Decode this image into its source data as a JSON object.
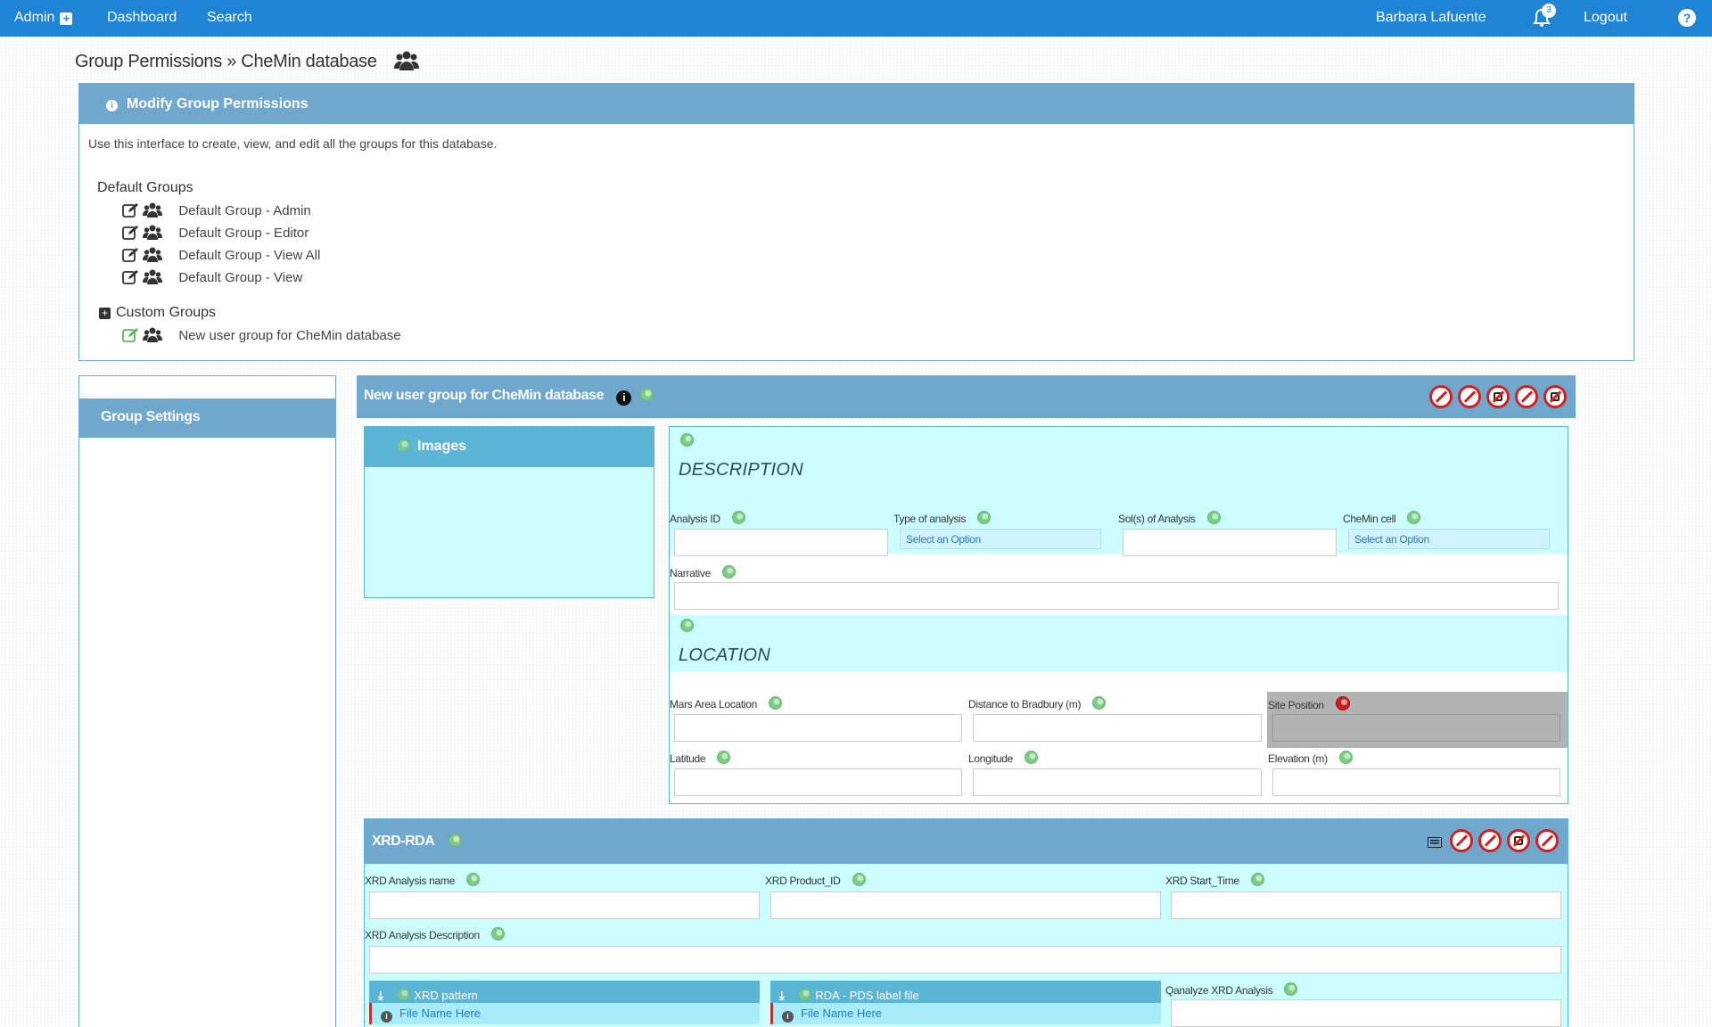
{
  "nav": {
    "admin": "Admin",
    "dashboard": "Dashboard",
    "search": "Search",
    "user": "Barbara Lafuente",
    "notif_count": "3",
    "logout": "Logout"
  },
  "page": {
    "title": "Group Permissions » CheMin database"
  },
  "modify": {
    "heading": "Modify Group Permissions",
    "intro": "Use this interface to create, view, and edit all the groups for this database.",
    "default_label": "Default Groups",
    "default_groups": [
      "Default Group - Admin",
      "Default Group - Editor",
      "Default Group - View All",
      "Default Group - View"
    ],
    "custom_label": "Custom Groups",
    "custom_groups": [
      "New user group for CheMin database"
    ]
  },
  "sidebar": {
    "group_settings": "Group Settings"
  },
  "group_panel": {
    "title": "New user group for CheMin database",
    "images_label": "Images",
    "description": {
      "heading": "DESCRIPTION",
      "analysis_id": "Analysis ID",
      "type_of_analysis": "Type of analysis",
      "sols": "Sol(s) of Analysis",
      "chemin_cell": "CheMin cell",
      "select_placeholder": "Select an Option",
      "narrative": "Narrative"
    },
    "location": {
      "heading": "LOCATION",
      "mars_area": "Mars Area Location",
      "distance": "Distance to Bradbury (m)",
      "site_position": "Site Position",
      "latitude": "Latitude",
      "longitude": "Longitude",
      "elevation": "Elevation (m)"
    },
    "xrd": {
      "title": "XRD-RDA",
      "analysis_name": "XRD Analysis name",
      "product_id": "XRD Product_ID",
      "start_time": "XRD Start_Time",
      "analysis_description": "XRD Analysis Description",
      "pattern_file": "XRD pattern",
      "pds_file": "RDA - PDS label file",
      "file_placeholder": "File Name Here",
      "qanalyze": "Qanalyze XRD Analysis"
    }
  },
  "colors": {
    "nav": "#2084d4",
    "panel_header": "#6fa8cc",
    "cyan_bg": "#ccfdff",
    "restrict_red": "#d42020"
  }
}
